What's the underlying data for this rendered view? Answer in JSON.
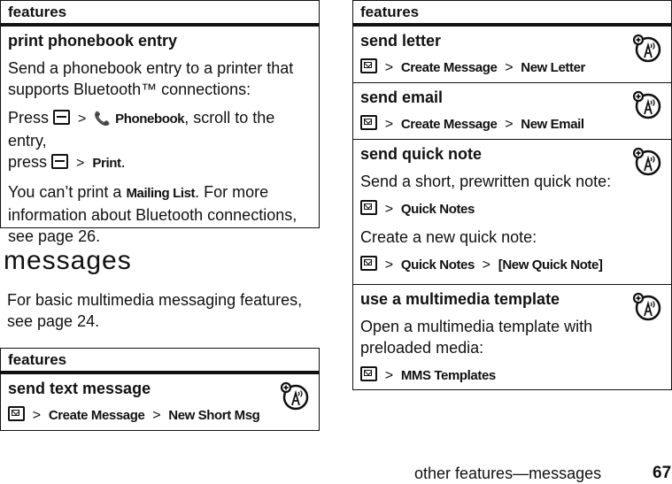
{
  "left_table_top": {
    "header": "features",
    "rows": [
      {
        "title": "print phonebook entry",
        "description": "Send a phonebook entry to a printer that supports Bluetooth™ connections:",
        "instruction": {
          "press1": "Press",
          "sep": ">",
          "phonebook": "Phonebook",
          "scroll": ", scroll to the entry,",
          "press2": "press",
          "print": "Print",
          "period": "."
        },
        "note": {
          "pre": "You can’t print a",
          "mailing_list": "Mailing List",
          "post": ". For more information about Bluetooth connections, see page 26."
        }
      }
    ]
  },
  "section": {
    "heading": "messages",
    "intro": "For basic multimedia messaging features, see page 24."
  },
  "left_table_bottom": {
    "header": "features",
    "rows": [
      {
        "title": "send text message",
        "path": [
          "Create Message",
          "New Short Msg"
        ]
      }
    ]
  },
  "right_table": {
    "header": "features",
    "rows": [
      {
        "title": "send letter",
        "path": [
          "Create Message",
          "New Letter"
        ]
      },
      {
        "title": "send email",
        "path": [
          "Create Message",
          "New Email"
        ]
      },
      {
        "title": "send quick note",
        "desc1": "Send a short, prewritten quick note:",
        "path1": [
          "Quick Notes"
        ],
        "desc2": "Create a new quick note:",
        "path2": [
          "Quick Notes",
          "[New Quick Note]"
        ]
      },
      {
        "title": "use a multimedia template",
        "desc1": "Open a multimedia template with preloaded media:",
        "path1": [
          "MMS Templates"
        ]
      }
    ]
  },
  "separator": ">",
  "icons": {
    "message": "message-key-icon",
    "menu": "menu-key-icon",
    "phonebook": "phonebook-icon",
    "network": "network-dependent-feature-icon"
  },
  "footer": {
    "running_title": "other features—messages",
    "page_number": "67"
  }
}
